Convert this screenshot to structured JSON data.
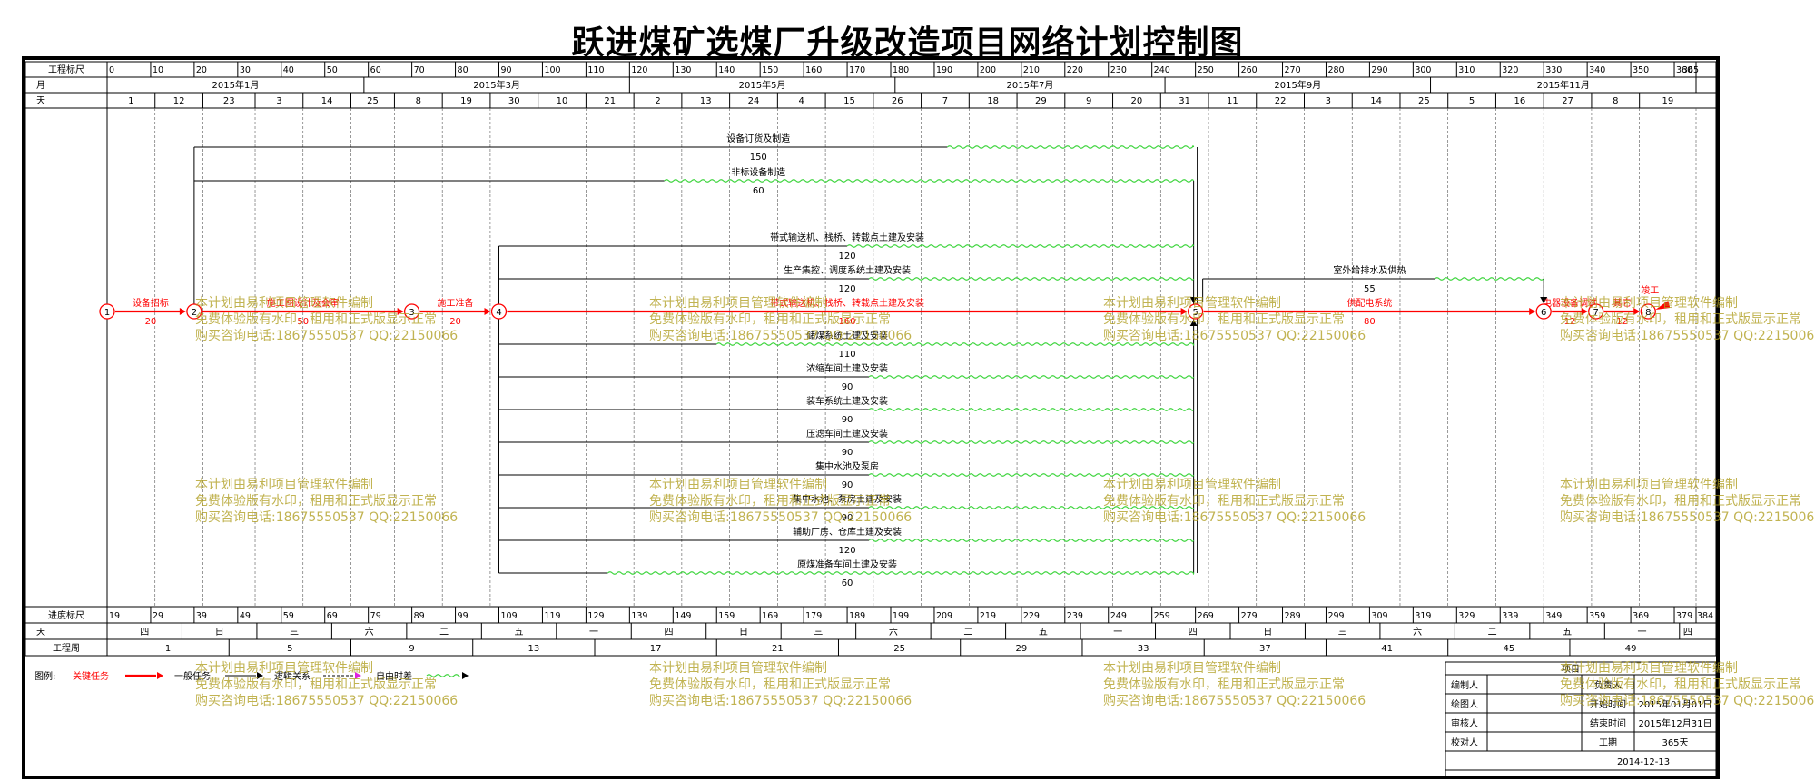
{
  "title": "跃进煤矿选煤厂升级改造项目网络计划控制图",
  "scale": {
    "total_days": 365,
    "row_labels": {
      "project_scale": "工程标尺",
      "month": "月",
      "day": "天",
      "progress_scale": "进度标尺",
      "weekday": "天",
      "week": "工程周"
    },
    "top_ticks": [
      0,
      10,
      20,
      30,
      40,
      50,
      60,
      70,
      80,
      90,
      100,
      110,
      120,
      130,
      140,
      150,
      160,
      170,
      180,
      190,
      200,
      210,
      220,
      230,
      240,
      250,
      260,
      270,
      280,
      290,
      300,
      310,
      320,
      330,
      340,
      350,
      360,
      365
    ],
    "months": [
      {
        "label": "2015年1月",
        "start": 0,
        "end": 59
      },
      {
        "label": "2015年3月",
        "start": 59,
        "end": 120
      },
      {
        "label": "2015年5月",
        "start": 120,
        "end": 181
      },
      {
        "label": "2015年7月",
        "start": 181,
        "end": 243
      },
      {
        "label": "2015年9月",
        "start": 243,
        "end": 304
      },
      {
        "label": "2015年11月",
        "start": 304,
        "end": 365
      }
    ],
    "day_labels": [
      {
        "d": 0,
        "t": "1"
      },
      {
        "d": 11,
        "t": "12"
      },
      {
        "d": 22,
        "t": "23"
      },
      {
        "d": 34,
        "t": "3"
      },
      {
        "d": 45,
        "t": "14"
      },
      {
        "d": 56,
        "t": "25"
      },
      {
        "d": 66,
        "t": "8"
      },
      {
        "d": 77,
        "t": "19"
      },
      {
        "d": 88,
        "t": "30"
      },
      {
        "d": 99,
        "t": "10"
      },
      {
        "d": 110,
        "t": "21"
      },
      {
        "d": 121,
        "t": "2"
      },
      {
        "d": 132,
        "t": "13"
      },
      {
        "d": 143,
        "t": "24"
      },
      {
        "d": 154,
        "t": "4"
      },
      {
        "d": 165,
        "t": "15"
      },
      {
        "d": 176,
        "t": "26"
      },
      {
        "d": 187,
        "t": "7"
      },
      {
        "d": 198,
        "t": "18"
      },
      {
        "d": 209,
        "t": "29"
      },
      {
        "d": 220,
        "t": "9"
      },
      {
        "d": 231,
        "t": "20"
      },
      {
        "d": 242,
        "t": "31"
      },
      {
        "d": 253,
        "t": "11"
      },
      {
        "d": 264,
        "t": "22"
      },
      {
        "d": 275,
        "t": "3"
      },
      {
        "d": 286,
        "t": "14"
      },
      {
        "d": 297,
        "t": "25"
      },
      {
        "d": 308,
        "t": "5"
      },
      {
        "d": 319,
        "t": "16"
      },
      {
        "d": 330,
        "t": "27"
      },
      {
        "d": 341,
        "t": "8"
      },
      {
        "d": 352,
        "t": "19"
      }
    ],
    "progress_ticks": [
      "19",
      "29",
      "39",
      "49",
      "59",
      "69",
      "79",
      "89",
      "99",
      "109",
      "119",
      "129",
      "139",
      "149",
      "159",
      "169",
      "179",
      "189",
      "199",
      "209",
      "219",
      "229",
      "239",
      "249",
      "259",
      "269",
      "279",
      "289",
      "299",
      "309",
      "319",
      "329",
      "339",
      "349",
      "359",
      "369",
      "379",
      "384"
    ],
    "weekdays": [
      "四",
      "日",
      "三",
      "六",
      "二",
      "五",
      "一",
      "四",
      "日",
      "三",
      "六",
      "二",
      "五",
      "一",
      "四",
      "日",
      "三",
      "六",
      "二",
      "五",
      "一",
      "四"
    ],
    "weeks": [
      "1",
      "5",
      "9",
      "13",
      "17",
      "21",
      "25",
      "29",
      "33",
      "37",
      "41",
      "45",
      "49"
    ]
  },
  "nodes": [
    {
      "id": "1",
      "day": 0
    },
    {
      "id": "2",
      "day": 20
    },
    {
      "id": "3",
      "day": 70
    },
    {
      "id": "4",
      "day": 90
    },
    {
      "id": "5",
      "day": 250
    },
    {
      "id": "6",
      "day": 330
    },
    {
      "id": "7",
      "day": 342
    },
    {
      "id": "8",
      "day": 354
    }
  ],
  "critical_tasks": [
    {
      "name": "设备招标",
      "duration": "20",
      "from": "1",
      "to": "2"
    },
    {
      "name": "施工图设计及会审",
      "duration": "50",
      "from": "2",
      "to": "3"
    },
    {
      "name": "施工准备",
      "duration": "20",
      "from": "3",
      "to": "4"
    },
    {
      "name": "带式输送机、栈桥、转载点土建及安装",
      "duration": "160",
      "from": "4",
      "to": "5"
    },
    {
      "name": "供配电系统",
      "duration": "80",
      "from": "5",
      "to": "6"
    },
    {
      "name": "电器设备调试",
      "duration": "12",
      "from": "6",
      "to": "7"
    },
    {
      "name": "其它",
      "duration": "12",
      "from": "7",
      "to": "8"
    },
    {
      "name": "竣工",
      "duration": "0",
      "from": "8",
      "to": "8"
    }
  ],
  "parallel_tasks": [
    {
      "name": "设备订货及制造",
      "duration": "150",
      "start": 20,
      "end": 250
    },
    {
      "name": "非标设备制造",
      "duration": "60",
      "start": 20,
      "end": 250
    },
    {
      "name": "带式输送机、栈桥、转载点土建及安装",
      "duration": "120",
      "start": 90,
      "end": 250
    },
    {
      "name": "生产集控、调度系统土建及安装",
      "duration": "120",
      "start": 90,
      "end": 250
    },
    {
      "name": "储煤系统土建及安装",
      "duration": "110",
      "start": 90,
      "end": 250
    },
    {
      "name": "浓缩车间土建及安装",
      "duration": "90",
      "start": 90,
      "end": 250
    },
    {
      "name": "装车系统土建及安装",
      "duration": "90",
      "start": 90,
      "end": 250
    },
    {
      "name": "压滤车间土建及安装",
      "duration": "90",
      "start": 90,
      "end": 250
    },
    {
      "name": "集中水池及泵房",
      "duration": "90",
      "start": 90,
      "end": 250
    },
    {
      "name": "集中水池、泵房土建及安装",
      "duration": "90",
      "start": 90,
      "end": 250
    },
    {
      "name": "辅助厂房、仓库土建及安装",
      "duration": "120",
      "start": 90,
      "end": 250
    },
    {
      "name": "原煤准备车间土建及安装",
      "duration": "60",
      "start": 90,
      "end": 250
    }
  ],
  "upper_task": {
    "name": "室外给排水及供热",
    "duration": "55",
    "start": 250,
    "end": 330
  },
  "legend": {
    "label": "图例:",
    "critical": "关键任务",
    "general": "一般任务",
    "logic": "逻辑关系",
    "float": "自由时差"
  },
  "info_table": {
    "header": "项目",
    "left_labels": [
      "编制人",
      "绘图人",
      "审核人",
      "校对人"
    ],
    "responsible": "负责人",
    "start_label": "开始时间",
    "start_value": "2015年01月01日",
    "end_label": "结束时间",
    "end_value": "2015年12月31日",
    "duration_label": "工期",
    "duration_value": "365天",
    "date": "2014-12-13"
  },
  "watermark": {
    "line1": "本计划由易利项目管理软件编制",
    "line2": "免费体验版有水印，租用和正式版显示正常",
    "line3": "购买咨询电话:18675550537 QQ:22150066"
  },
  "colors": {
    "critical": "#ff0000",
    "float": "#3bd43b",
    "general": "#000000",
    "grid": "#000000",
    "watermark": "#b09e20"
  }
}
